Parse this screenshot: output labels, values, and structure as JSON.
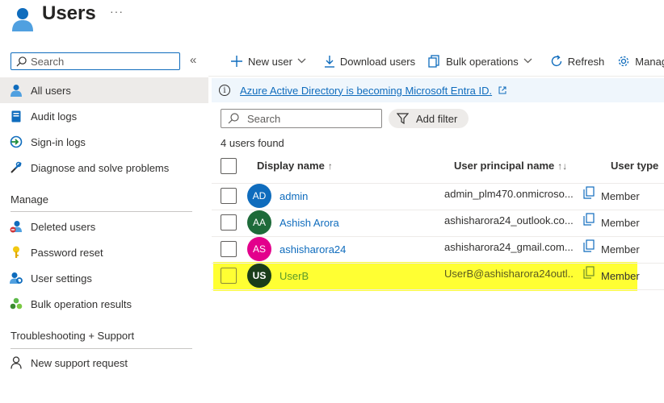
{
  "header": {
    "title": "Users",
    "more": "···"
  },
  "nav": {
    "search_placeholder": "Search",
    "collapse": "«",
    "items": [
      {
        "label": "All users",
        "icon": "user-icon",
        "active": true
      },
      {
        "label": "Audit logs",
        "icon": "audit-log-icon"
      },
      {
        "label": "Sign-in logs",
        "icon": "sign-in-icon"
      },
      {
        "label": "Diagnose and solve problems",
        "icon": "wrench-icon"
      }
    ],
    "manage_title": "Manage",
    "manage_items": [
      {
        "label": "Deleted users",
        "icon": "deleted-user-icon"
      },
      {
        "label": "Password reset",
        "icon": "key-icon"
      },
      {
        "label": "User settings",
        "icon": "user-settings-icon"
      },
      {
        "label": "Bulk operation results",
        "icon": "bulk-results-icon"
      }
    ],
    "support_title": "Troubleshooting + Support",
    "support_items": [
      {
        "label": "New support request",
        "icon": "support-icon"
      }
    ]
  },
  "toolbar": {
    "new_user": "New user",
    "download_users": "Download users",
    "bulk_operations": "Bulk operations",
    "refresh": "Refresh",
    "manage": "Manag"
  },
  "banner": {
    "text": "Azure Active Directory is becoming Microsoft Entra ID."
  },
  "filter": {
    "search_placeholder": "Search",
    "add_filter": "Add filter"
  },
  "results": {
    "count_text": "4 users found"
  },
  "table": {
    "columns": {
      "display_name": "Display name",
      "display_name_sort": "↑",
      "upn": "User principal name",
      "upn_sort": "↑↓",
      "user_type": "User type"
    },
    "rows": [
      {
        "initials": "AD",
        "name": "admin",
        "upn": "admin_plm470.onmicroso...",
        "type": "Member",
        "color": "#0f6cbd"
      },
      {
        "initials": "AA",
        "name": "Ashish Arora",
        "upn": "ashisharora24_outlook.co...",
        "type": "Member",
        "color": "#1e6b3a"
      },
      {
        "initials": "AS",
        "name": "ashisharora24",
        "upn": "ashisharora24_gmail.com...",
        "type": "Member",
        "color": "#e3008c"
      },
      {
        "initials": "US",
        "name": "UserB",
        "upn": "UserB@ashisharora24outl...",
        "type": "Member",
        "color": "#1a3d1a",
        "highlighted": true
      }
    ]
  },
  "colors": {
    "accent": "#0f6cbd",
    "highlight": "#ffff33"
  }
}
